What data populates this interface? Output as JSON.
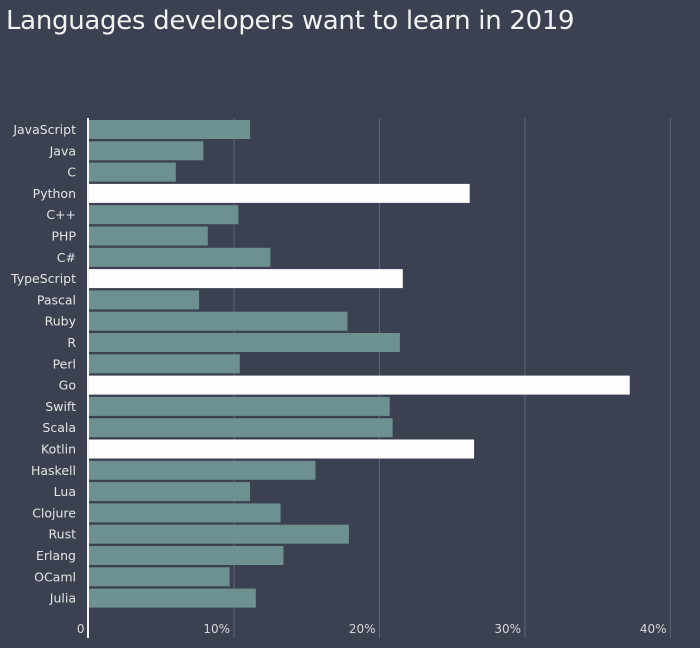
{
  "chart_data": {
    "type": "bar",
    "orientation": "horizontal",
    "title": "Languages developers want to learn in 2019",
    "xlabel": "",
    "ylabel": "",
    "xlim": [
      0,
      42
    ],
    "x_ticks": [
      0,
      10,
      20,
      30,
      40
    ],
    "x_tick_labels": [
      "0",
      "10%",
      "20%",
      "30%",
      "40%"
    ],
    "grid": "vertical",
    "legend": "none",
    "categories": [
      "JavaScript",
      "Java",
      "C",
      "Python",
      "C++",
      "PHP",
      "C#",
      "TypeScript",
      "Pascal",
      "Ruby",
      "R",
      "Perl",
      "Go",
      "Swift",
      "Scala",
      "Kotlin",
      "Haskell",
      "Lua",
      "Clojure",
      "Rust",
      "Erlang",
      "OCaml",
      "Julia"
    ],
    "values": [
      11.1,
      7.9,
      6.0,
      26.2,
      10.3,
      8.2,
      12.5,
      21.6,
      7.6,
      17.8,
      21.4,
      10.4,
      37.2,
      20.7,
      20.9,
      26.5,
      15.6,
      11.1,
      13.2,
      17.9,
      13.4,
      9.7,
      11.5
    ],
    "highlighted": [
      "Python",
      "TypeScript",
      "Go",
      "Kotlin"
    ],
    "colors": {
      "background": "#3b4150",
      "bar": "#6d9090",
      "highlight": "#fdfdfd",
      "grid": "#5d6473",
      "axis": "#f5f5f5",
      "text": "#e4e4e4"
    }
  }
}
